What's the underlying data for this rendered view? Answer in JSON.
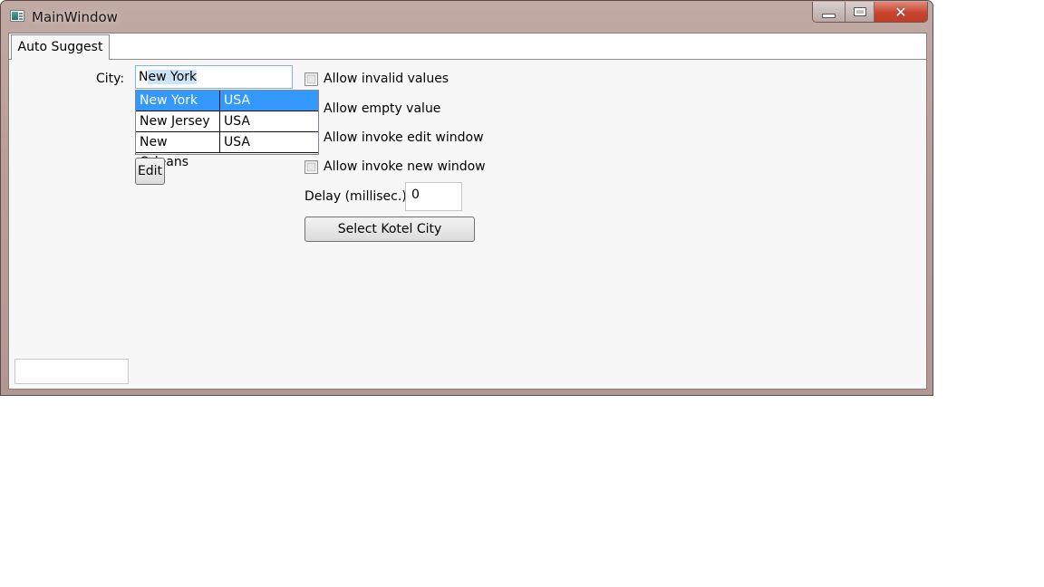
{
  "window": {
    "title": "MainWindow",
    "controls": {
      "minimize": "minimize",
      "maximize": "maximize",
      "close": "✕"
    }
  },
  "tabs": [
    {
      "label": "Auto Suggest",
      "active": true
    }
  ],
  "form": {
    "city_label": "City:",
    "city_value_prefix": "N",
    "city_value_selected": "ew York",
    "suggestions": [
      {
        "city": "New York",
        "country": "USA",
        "selected": true
      },
      {
        "city": "New Jersey",
        "country": "USA",
        "selected": false
      },
      {
        "city": "New Orleans",
        "country": "USA",
        "selected": false
      }
    ],
    "edit_button": "Edit",
    "options": [
      {
        "label": "Allow invalid values",
        "checked": false
      },
      {
        "label": "Allow empty value",
        "checked": false
      },
      {
        "label": "Allow invoke edit window",
        "checked": false
      },
      {
        "label": "Allow invoke new window",
        "checked": false
      }
    ],
    "delay_label": "Delay (millisec.):",
    "delay_value": "0",
    "select_button": "Select Kotel City",
    "bottom_input_value": ""
  },
  "colors": {
    "selection": "#3399ff",
    "close_button": "#c8452f"
  }
}
